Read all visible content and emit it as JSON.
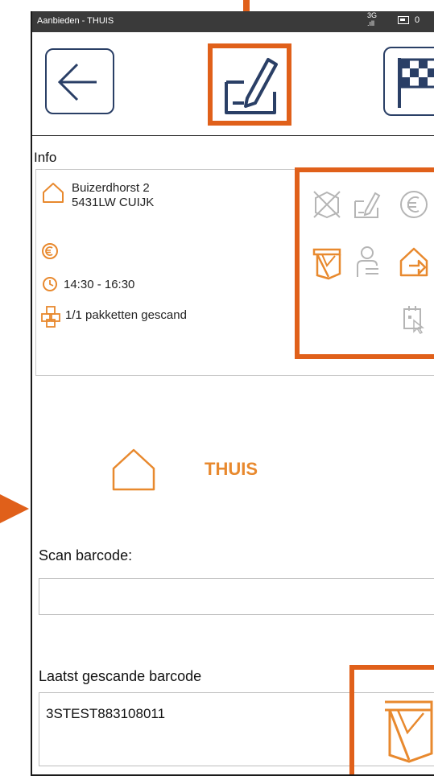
{
  "statusbar": {
    "title": "Aanbieden - THUIS",
    "network": "3G",
    "battery_tail": "0"
  },
  "toolbar": {
    "back": "back-arrow",
    "edit": "sign-edit",
    "finish": "checkered-flag"
  },
  "info": {
    "title": "Info",
    "address_line1": "Buizerdhorst 2",
    "address_line2": "5431LW CUIJK",
    "time": "14:30 - 16:30",
    "packages": "1/1 pakketten gescand"
  },
  "delivery": {
    "label": "THUIS"
  },
  "scan": {
    "label": "Scan barcode:",
    "value": ""
  },
  "last": {
    "label": "Laatst gescande barcode",
    "value": "3STEST883108011"
  },
  "colors": {
    "accent": "#e8892e",
    "highlight": "#e0601a",
    "icon_navy": "#2a3f66",
    "disabled": "#b5b5b5"
  }
}
